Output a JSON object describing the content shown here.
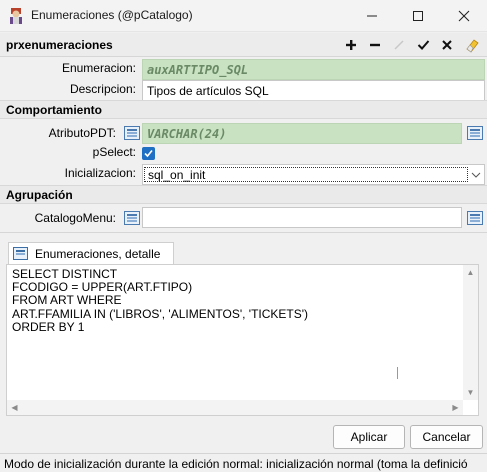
{
  "window": {
    "title": "Enumeraciones (@pCatalogo)"
  },
  "toolbar": {
    "form_name": "prxenumeraciones"
  },
  "fields": {
    "enumeracion": {
      "label": "Enumeracion:",
      "value": "auxARTTIPO_SQL"
    },
    "descripcion": {
      "label": "Descripcion:",
      "value": "Tipos de artículos SQL"
    },
    "atributo_pdt": {
      "label": "AtributoPDT:",
      "value": "VARCHAR(24)"
    },
    "pselect": {
      "label": "pSelect:",
      "checked": true
    },
    "inicializacion": {
      "label": "Inicializacion:",
      "value": "sql_on_init"
    },
    "catalogo_menu": {
      "label": "CatalogoMenu:",
      "value": ""
    }
  },
  "sections": {
    "comportamiento": "Comportamiento",
    "agrupacion": "Agrupación"
  },
  "detail_tab": {
    "label": "Enumeraciones, detalle",
    "sql": "SELECT DISTINCT\nFCODIGO = UPPER(ART.FTIPO)\nFROM ART WHERE\nART.FFAMILIA IN ('LIBROS', 'ALIMENTOS', 'TICKETS')\nORDER BY 1"
  },
  "buttons": {
    "apply": "Aplicar",
    "cancel": "Cancelar"
  },
  "status": {
    "text": "Modo de inicialización durante la edición normal: inicialización normal (toma la definició"
  },
  "colors": {
    "readonly_field": "#c9e2c2",
    "checkbox": "#1f6fc4"
  }
}
